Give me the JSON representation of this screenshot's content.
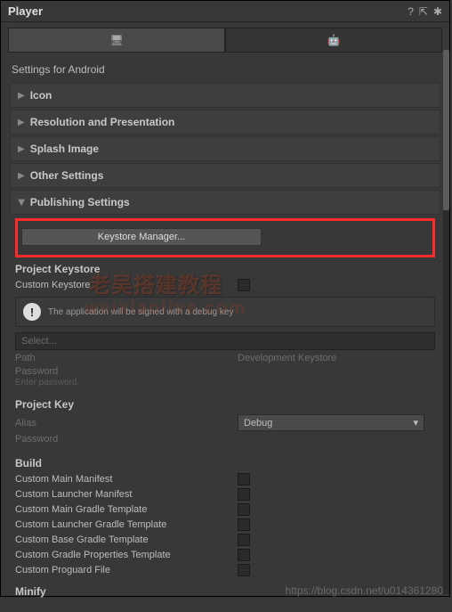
{
  "titlebar": {
    "title": "Player"
  },
  "tabs": {
    "desktop_icon": "🖥",
    "android_icon": "🤖"
  },
  "subtitle": "Settings for Android",
  "sections": {
    "icon": "Icon",
    "resolution": "Resolution and Presentation",
    "splash": "Splash Image",
    "other": "Other Settings",
    "publishing": "Publishing Settings"
  },
  "publishing": {
    "button": "Keystore Manager...",
    "project_keystore": "Project Keystore",
    "custom_keystore": "Custom Keystore",
    "info": "The application will be signed with a debug key",
    "select": "Select...",
    "path_label": "Path",
    "path_value": "Development Keystore",
    "password_label": "Password",
    "password_placeholder": "Enter password.",
    "project_key": "Project Key",
    "alias_label": "Alias",
    "alias_value": "Debug",
    "key_password_label": "Password",
    "build": "Build",
    "build_items": [
      "Custom Main Manifest",
      "Custom Launcher Manifest",
      "Custom Main Gradle Template",
      "Custom Launcher Gradle Template",
      "Custom Base Gradle Template",
      "Custom Gradle Properties Template",
      "Custom Proguard File"
    ],
    "minify": "Minify"
  },
  "watermark": {
    "line1": "老吴搭建教程",
    "line2": "weixiaolive.com"
  },
  "footer": "https://blog.csdn.net/u014361280"
}
